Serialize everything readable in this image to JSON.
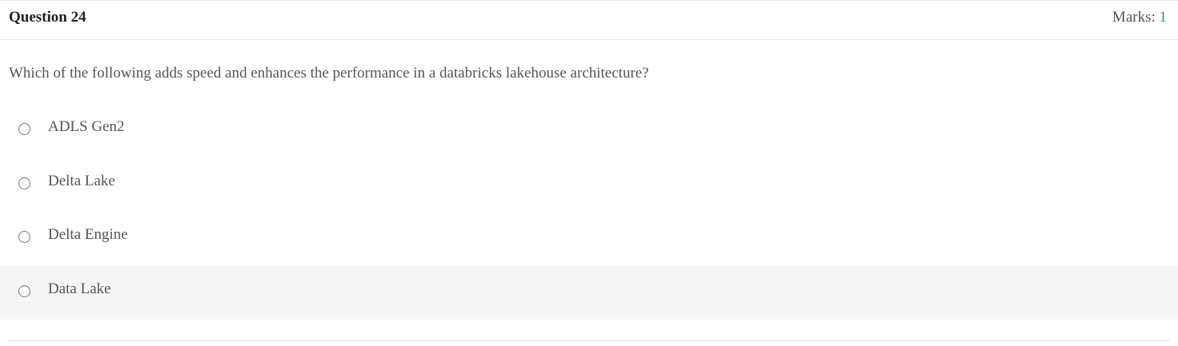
{
  "question": {
    "title": "Question 24",
    "marks_label": "Marks: ",
    "marks_value": "1",
    "text": "Which of the following adds speed and enhances the performance in a databricks lakehouse architecture?"
  },
  "options": [
    {
      "label": "ADLS Gen2"
    },
    {
      "label": "Delta Lake"
    },
    {
      "label": "Delta Engine"
    },
    {
      "label": "Data Lake"
    }
  ],
  "colors": {
    "marks_accent": "#3a9a3a",
    "hover_background": "#f5f5f5"
  }
}
